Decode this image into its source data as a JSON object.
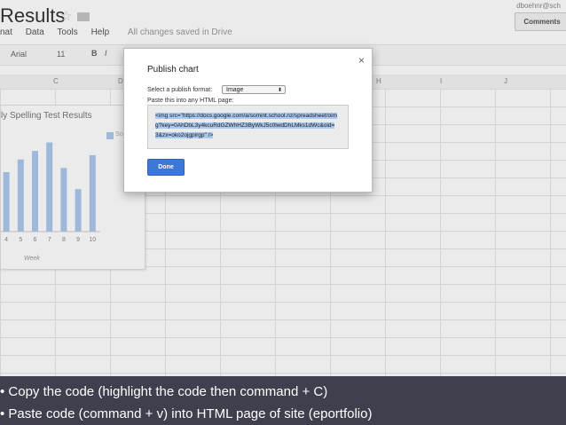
{
  "doc": {
    "title": "Results",
    "star_icon": "star-icon",
    "folder_icon": "folder-icon",
    "email": "dboehnr@sch",
    "comments_label": "Comments"
  },
  "menu": {
    "items": [
      "nat",
      "Data",
      "Tools",
      "Help"
    ],
    "saved_status": "All changes saved in Drive"
  },
  "toolbar": {
    "font": "Arial",
    "font_size": "11",
    "bold": "B",
    "italic": "I"
  },
  "columns": [
    "C",
    "D",
    "H",
    "I",
    "J"
  ],
  "chart_data": {
    "type": "bar",
    "title": "ly Spelling Test Results",
    "legend": [
      "Sco"
    ],
    "categories": [
      "4",
      "5",
      "6",
      "7",
      "8",
      "9",
      "10"
    ],
    "values": [
      14,
      17,
      19,
      21,
      15,
      10,
      18
    ],
    "ylim": [
      0,
      23
    ],
    "xlabel": "Week",
    "colors": {
      "bar": "#adc8ec"
    }
  },
  "dialog": {
    "title": "Publish chart",
    "close_label": "×",
    "format_label": "Select a publish format:",
    "format_value": "Image",
    "format_arrow": "⬍",
    "paste_label": "Paste this into any HTML page:",
    "code": "<img src=\"https://docs.google.com/a/somint.school.nz/spreadsheet/oimg?key=0AhDbL3y4kcuRdGZWhHZ3ByWkJ5c0lwdDhLMks1dWc&oid=3&zx=oko2ojgpirgp\" />",
    "done_label": "Done"
  },
  "caption": {
    "line1": "• Copy the code (highlight the code then command + C)",
    "line2": "• Paste code (command + v) into HTML page of site (eportfolio)"
  },
  "colors": {
    "caption_bg": "#3f3f4e",
    "done_button": "#3c78d8",
    "code_highlight": "#a9c8f0"
  }
}
